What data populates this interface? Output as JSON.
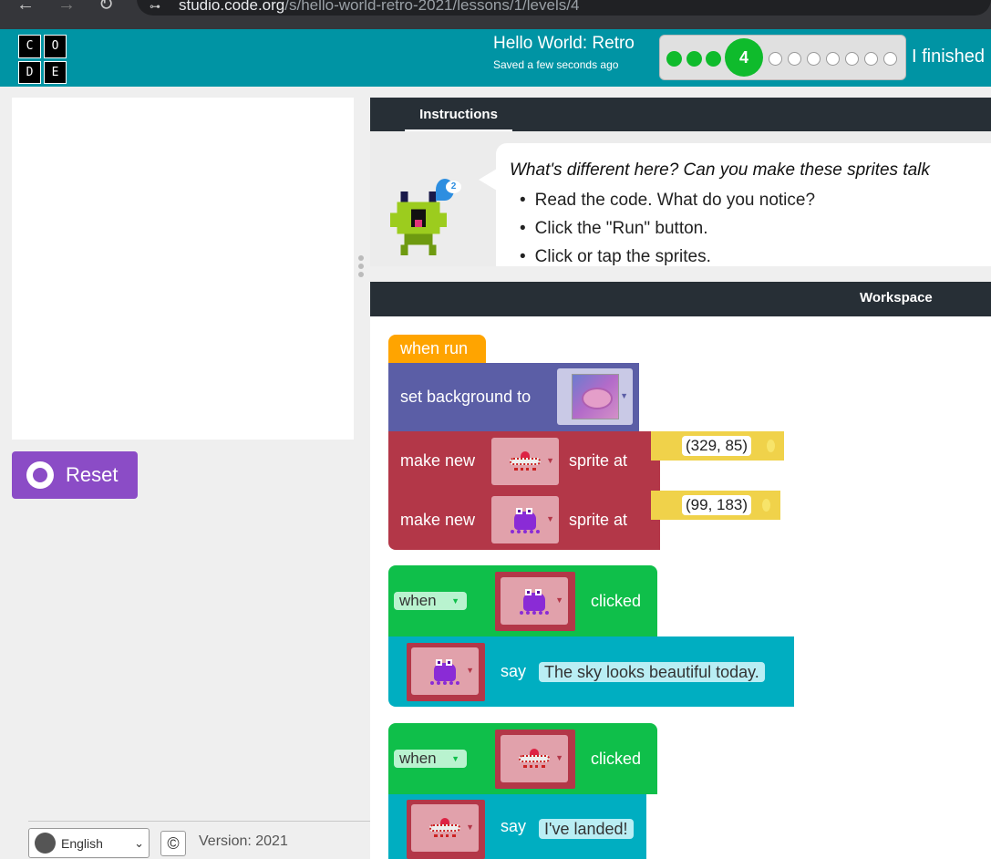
{
  "browser": {
    "url_host": "studio.code.org",
    "url_path": "/s/hello-world-retro-2021/lessons/1/levels/4"
  },
  "header": {
    "logo_letters": [
      "C",
      "O",
      "D",
      "E"
    ],
    "title": "Hello World: Retro",
    "saved": "Saved a few seconds ago",
    "current_level": "4",
    "finished_label": "I finished"
  },
  "left": {
    "reset_label": "Reset",
    "language": "English",
    "copyright": "©",
    "version": "Version: 2021"
  },
  "instructions": {
    "tab": "Instructions",
    "hint_count": "2",
    "question": "What's different here? Can you make these sprites talk",
    "bullets": [
      "Read the code. What do you notice?",
      "Click the \"Run\" button.",
      "Click or tap the sprites."
    ]
  },
  "workspace": {
    "title": "Workspace",
    "when_run": "when run",
    "set_background": "set background to",
    "make_new": "make new",
    "sprite_at": "sprite at",
    "coords_1": "(329, 85)",
    "coords_2": "(99, 183)",
    "when": "when",
    "clicked": "clicked",
    "say": "say",
    "say_1": "The sky looks beautiful today.",
    "say_2": "I've landed!"
  },
  "colors": {
    "header": "#0094a4",
    "progress_done": "#0fbb2c",
    "reset": "#8b4cc6",
    "event": "#ffa400",
    "world": "#5b5ea6",
    "sprites": "#b33748",
    "events_green": "#0fbf4a",
    "say_teal": "#00aec1"
  },
  "progress": {
    "done_before": 3,
    "total_after": 8
  }
}
